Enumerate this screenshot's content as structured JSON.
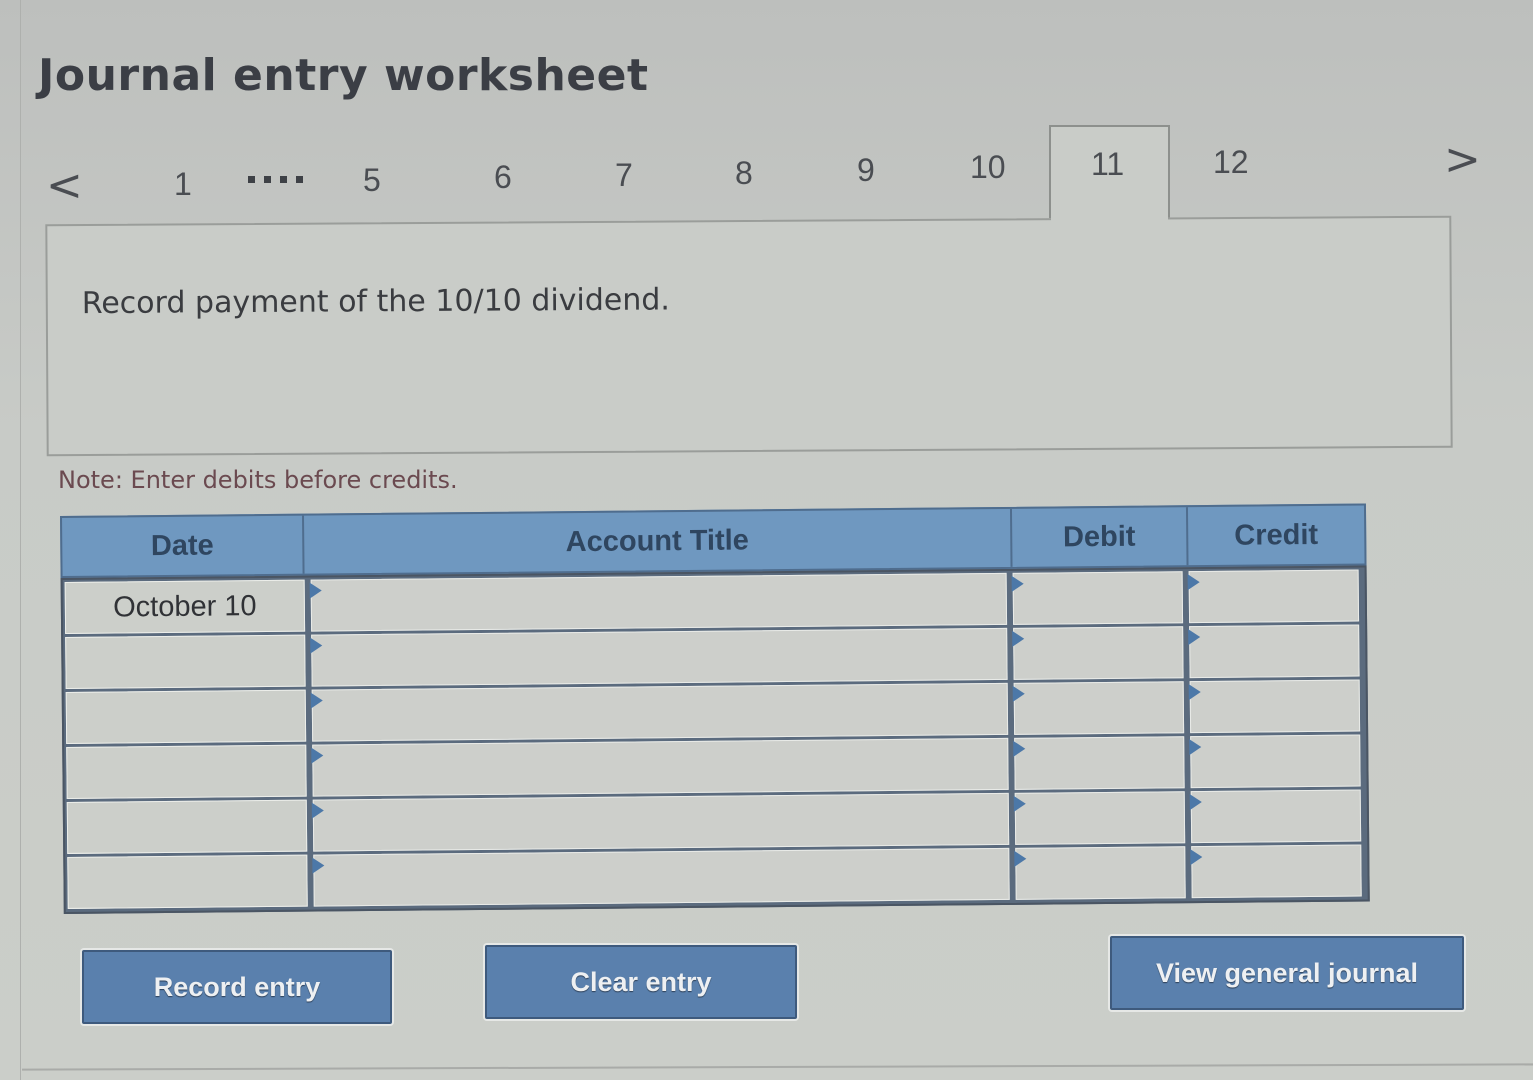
{
  "title": "Journal entry worksheet",
  "pagination": {
    "prev_icon": "chevron-left-icon",
    "next_icon": "chevron-right-icon",
    "prev_glyph": "<",
    "next_glyph": ">",
    "pages": [
      "1",
      "5",
      "6",
      "7",
      "8",
      "9",
      "10",
      "11",
      "12"
    ],
    "ellipsis": "....",
    "active_page": "11"
  },
  "question": {
    "text": "Record payment of the 10/10 dividend."
  },
  "note": "Note: Enter debits before credits.",
  "journal": {
    "columns": [
      "Date",
      "Account Title",
      "Debit",
      "Credit"
    ],
    "rows": [
      {
        "date": "October 10",
        "account": "",
        "debit": "",
        "credit": ""
      },
      {
        "date": "",
        "account": "",
        "debit": "",
        "credit": ""
      },
      {
        "date": "",
        "account": "",
        "debit": "",
        "credit": ""
      },
      {
        "date": "",
        "account": "",
        "debit": "",
        "credit": ""
      },
      {
        "date": "",
        "account": "",
        "debit": "",
        "credit": ""
      },
      {
        "date": "",
        "account": "",
        "debit": "",
        "credit": ""
      }
    ]
  },
  "buttons": {
    "record": "Record entry",
    "clear": "Clear entry",
    "view": "View general journal"
  },
  "colors": {
    "header_blue": "#6f98c0",
    "button_blue": "#5a80ad",
    "note_text": "#6b4a50"
  }
}
